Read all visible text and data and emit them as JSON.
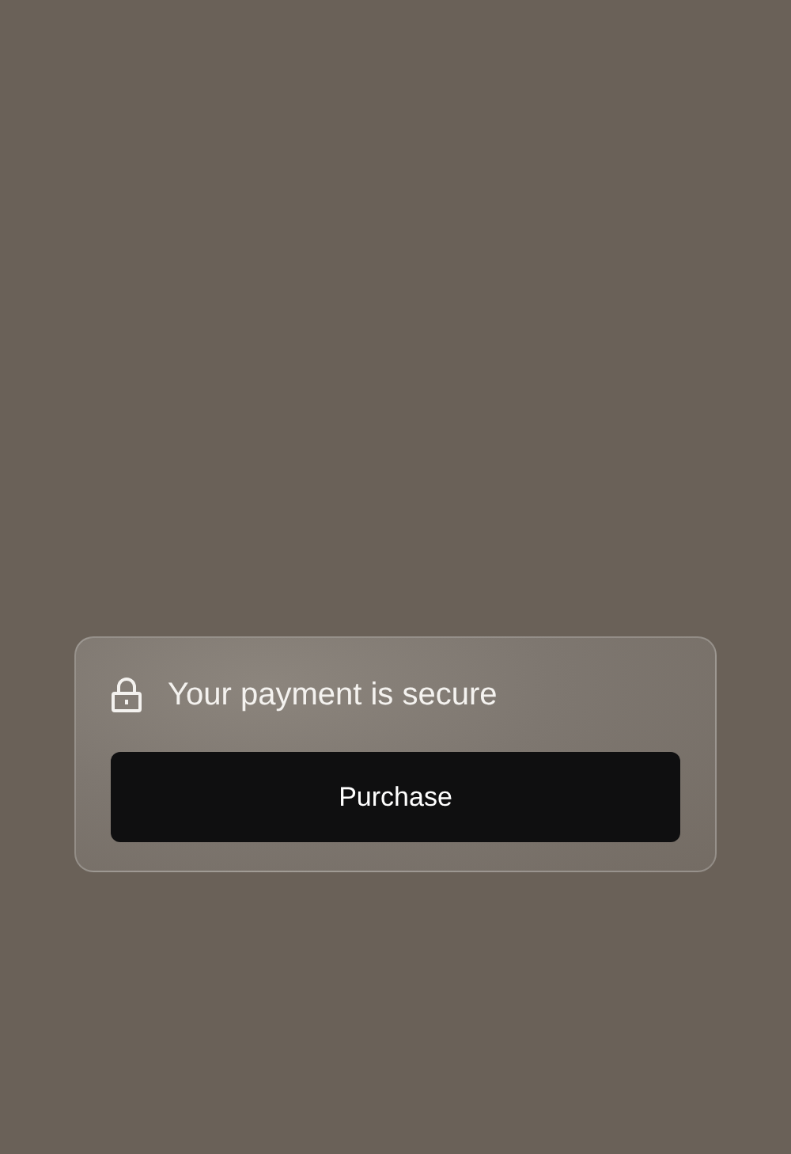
{
  "card": {
    "title": "Your payment is secure",
    "button": "Purchase"
  }
}
